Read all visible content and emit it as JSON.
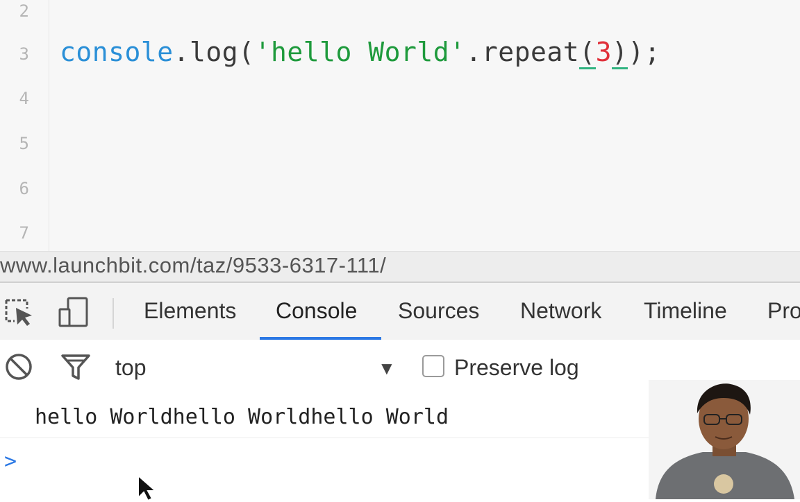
{
  "editor": {
    "line_numbers": [
      "2",
      "3",
      "4",
      "5",
      "6",
      "7"
    ],
    "code": {
      "object": "console",
      "dot1": ".",
      "method": "log",
      "open1": "(",
      "string": "'hello World'",
      "dot2": ".",
      "method2": "repeat",
      "open2": "(",
      "arg": "3",
      "close2": ")",
      "close1": ")",
      "semi": ";"
    }
  },
  "statusbar": {
    "url": "www.launchbit.com/taz/9533-6317-111/"
  },
  "devtools": {
    "tabs": [
      "Elements",
      "Console",
      "Sources",
      "Network",
      "Timeline",
      "Pro"
    ],
    "active_tab": "Console",
    "accent": "#2b78e4",
    "icons": [
      "inspect-element-icon",
      "device-mode-icon"
    ]
  },
  "console": {
    "toolbar": {
      "clear_icon": "clear-console-icon",
      "filter_icon": "filter-icon",
      "context_value": "top",
      "dropdown_arrow": "▼",
      "preserve_log_label": "Preserve log",
      "preserve_log_checked": false
    },
    "output": [
      "hello Worldhello Worldhello World"
    ],
    "prompt_symbol": ">"
  }
}
